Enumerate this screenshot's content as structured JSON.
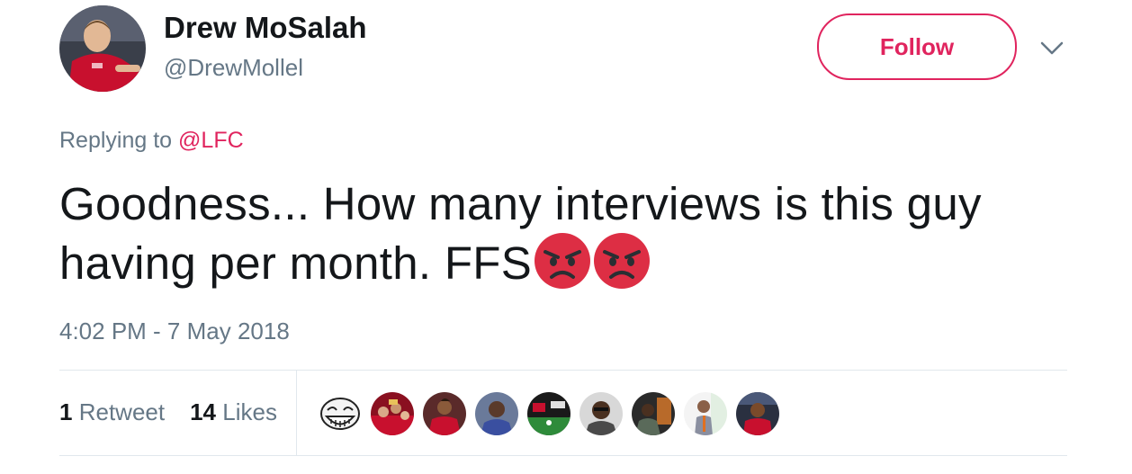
{
  "user": {
    "display_name": "Drew MoSalah",
    "handle": "@DrewMollel"
  },
  "follow_button": {
    "label": "Follow"
  },
  "reply": {
    "prefix": "Replying to",
    "mention": "@LFC"
  },
  "tweet": {
    "text_line1": "Goodness... How many interviews is this guy",
    "text_line2": "having per month. FFS",
    "emojis": [
      "angry-face",
      "angry-face"
    ]
  },
  "timestamp": "4:02 PM - 7 May 2018",
  "stats": {
    "retweets_count": "1",
    "retweets_label": "Retweet",
    "likes_count": "14",
    "likes_label": "Likes"
  },
  "likers": [
    {
      "icon": "trollface-avatar"
    },
    {
      "icon": "fans-avatar"
    },
    {
      "icon": "player-avatar"
    },
    {
      "icon": "person-avatar"
    },
    {
      "icon": "stadium-avatar"
    },
    {
      "icon": "person-avatar"
    },
    {
      "icon": "person-avatar"
    },
    {
      "icon": "person-avatar"
    },
    {
      "icon": "player-avatar"
    }
  ],
  "colors": {
    "accent": "#e0245e",
    "text": "#14171a",
    "muted": "#657786",
    "border": "#e1e8ed",
    "emoji_red": "#dd2e44"
  }
}
